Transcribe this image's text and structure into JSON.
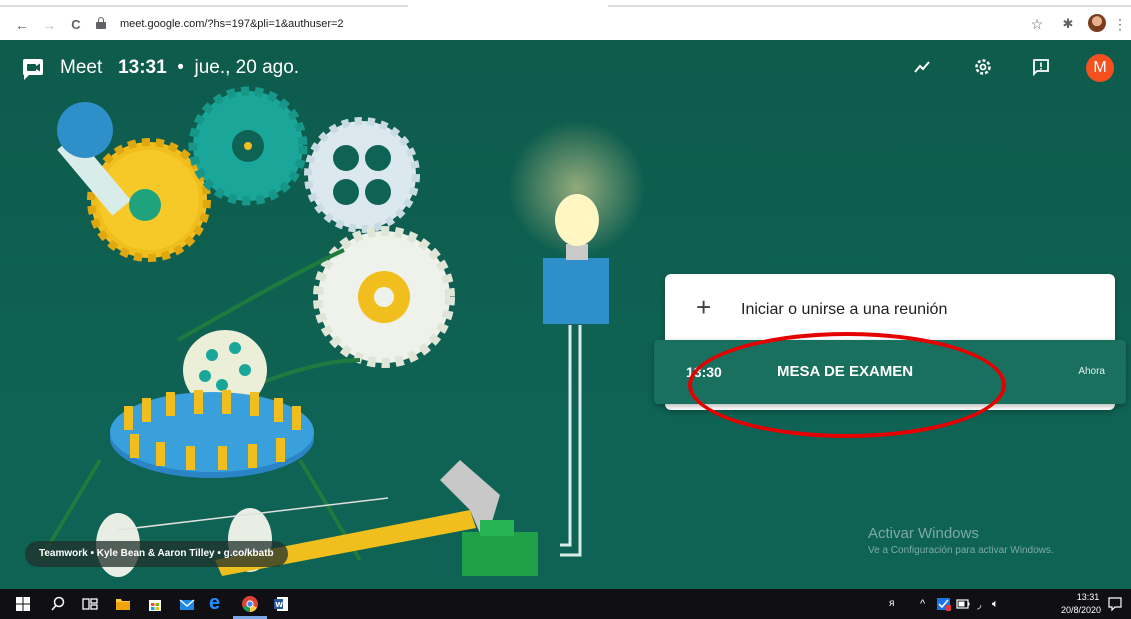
{
  "browser": {
    "url": "meet.google.com/?hs=197&pli=1&authuser=2",
    "nav_back": "←",
    "nav_forward": "→",
    "nav_reload": "C"
  },
  "meet": {
    "app_name": "Meet",
    "time": "13:31",
    "separator": "•",
    "date": "jue., 20 ago.",
    "avatar_letter": "M",
    "new_meeting_plus": "+",
    "new_meeting_label": "Iniciar o unirse a una reunión",
    "meeting": {
      "time": "13:30",
      "name": "MESA DE EXAMEN",
      "status": "Ahora"
    },
    "credit": "Teamwork  •  Kyle Bean & Aaron Tilley  •  g.co/kbatb",
    "accent_color": "#f4511e"
  },
  "windows": {
    "watermark_title": "Activar Windows",
    "watermark_subtitle": "Ve a Configuración para activar Windows.",
    "clock_time": "13:31",
    "clock_date": "20/8/2020"
  }
}
